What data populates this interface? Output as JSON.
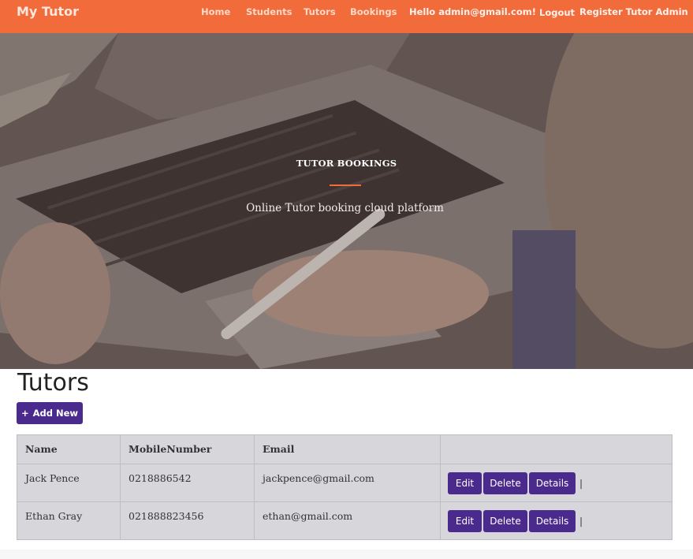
{
  "navbar": {
    "brand": "My Tutor",
    "items": [
      {
        "label": "Home"
      },
      {
        "label": "Students"
      },
      {
        "label": "Tutors"
      },
      {
        "label": "Bookings"
      }
    ],
    "greeting": "Hello admin@gmail.com!",
    "logout": "Logout",
    "register": "Register Tutor Admin",
    "color": "#f26b3a"
  },
  "hero": {
    "title": "TUTOR BOOKINGS",
    "subtitle": "Online Tutor booking cloud platform",
    "accent": "#f26b3a"
  },
  "main": {
    "title": "Tutors",
    "add_label": "Add New",
    "add_icon": "plus-icon",
    "button_color": "#4b2a8e"
  },
  "table": {
    "headers": [
      "Name",
      "MobileNumber",
      "Email",
      ""
    ],
    "rows": [
      {
        "name": "Jack Pence",
        "mobile": "0218886542",
        "email": "jackpence@gmail.com"
      },
      {
        "name": "Ethan Gray",
        "mobile": "021888823456",
        "email": "ethan@gmail.com"
      }
    ],
    "actions": {
      "edit": "Edit",
      "delete": "Delete",
      "details": "Details",
      "separator": "|"
    }
  }
}
